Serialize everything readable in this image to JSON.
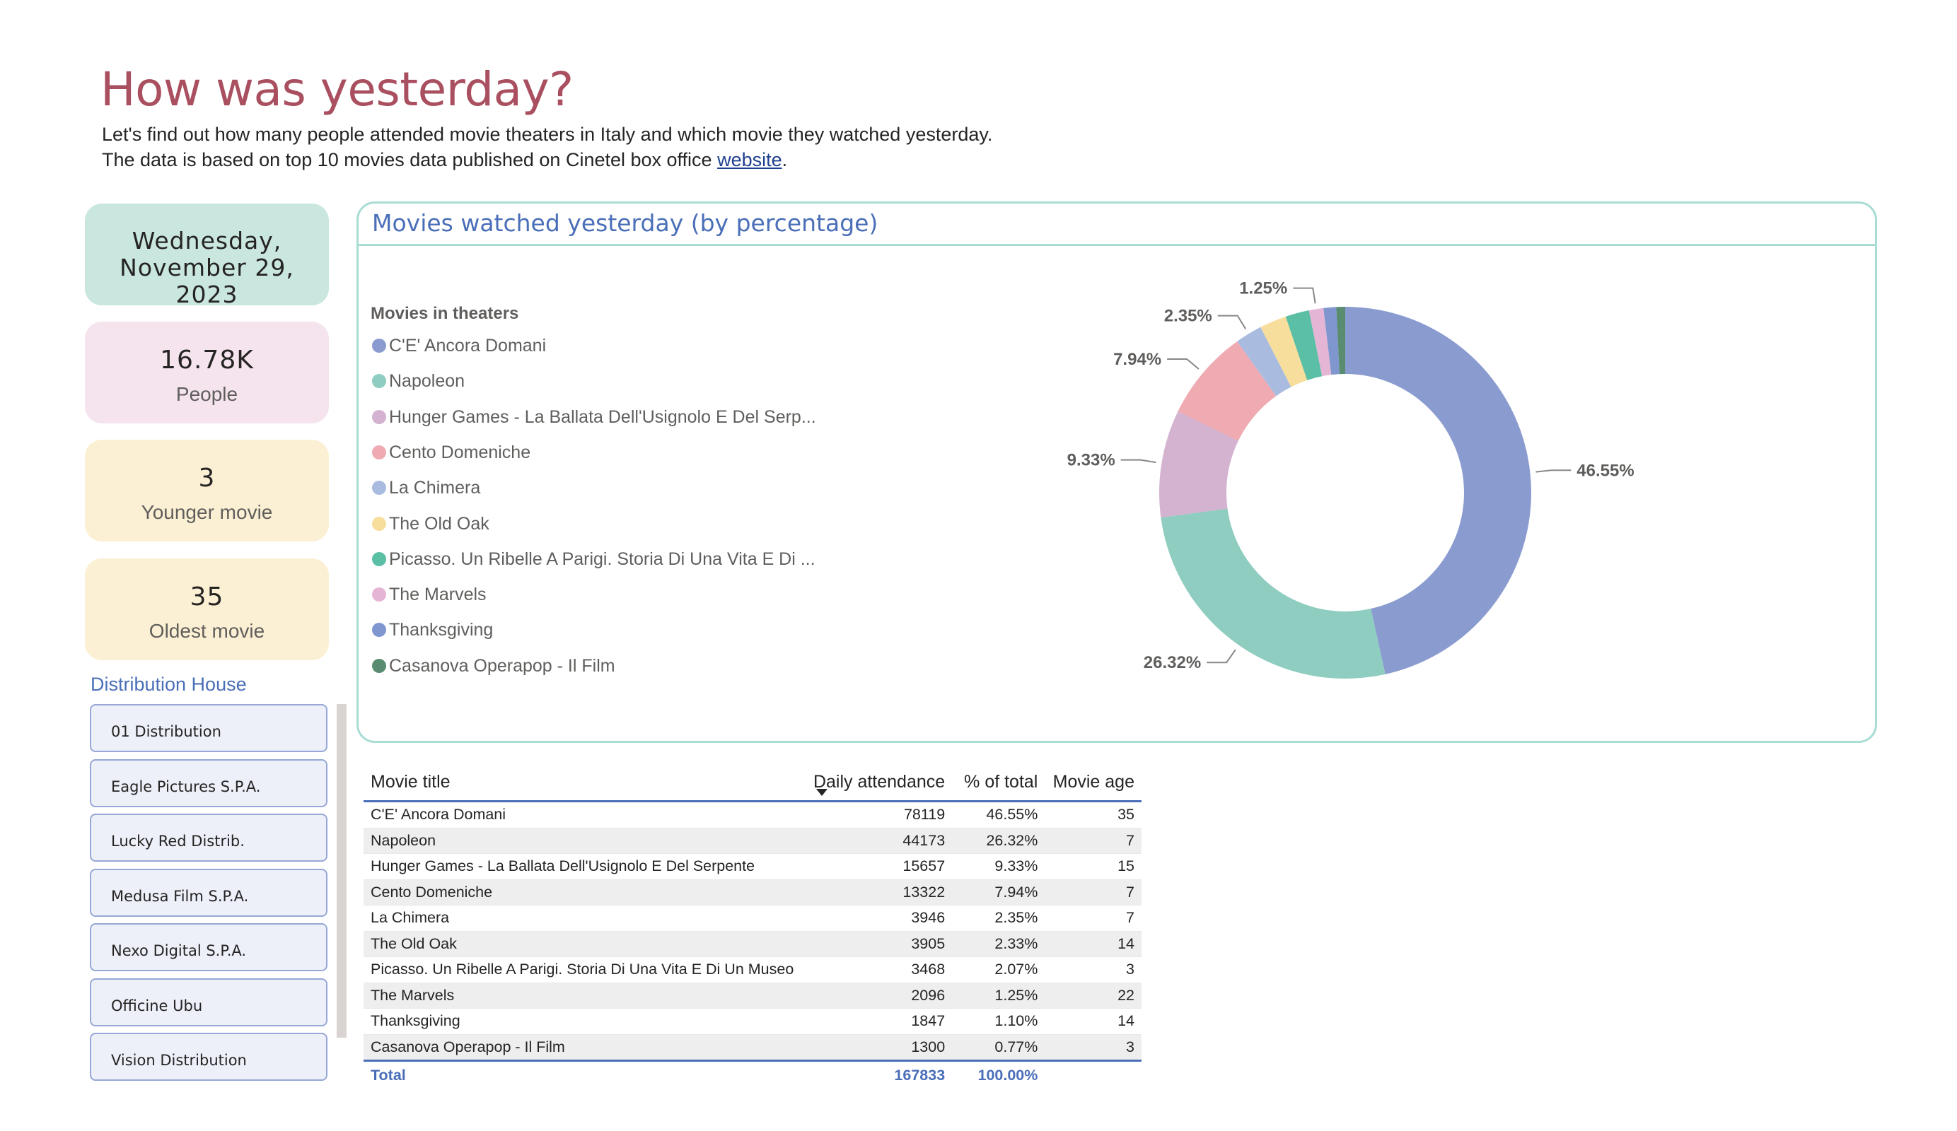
{
  "header": {
    "title": "How was yesterday?",
    "subtitle_line1": "Let's find out how many people attended movie theaters in Italy and which movie they watched yesterday.",
    "subtitle_line2_prefix": "The data is based on top 10 movies data published on Cinetel box office ",
    "subtitle_link": "website",
    "subtitle_line2_suffix": "."
  },
  "cards": {
    "date_line1": "Wednesday,",
    "date_line2": "November 29, 2023",
    "people_value": "16.78K",
    "people_label": "People",
    "younger_value": "3",
    "younger_label": "Younger movie",
    "oldest_value": "35",
    "oldest_label": "Oldest movie"
  },
  "distribution": {
    "title": "Distribution House",
    "items": [
      "01 Distribution",
      "Eagle Pictures S.P.A.",
      "Lucky Red Distrib.",
      "Medusa Film S.P.A.",
      "Nexo Digital S.P.A.",
      "Officine Ubu",
      "Vision Distribution"
    ]
  },
  "donut": {
    "title": "Movies watched yesterday (by percentage)",
    "legend_title": "Movies in theaters",
    "legend": [
      {
        "label": "C'E' Ancora Domani",
        "color": "#8a9bcf"
      },
      {
        "label": "Napoleon",
        "color": "#8ecdc0"
      },
      {
        "label": "Hunger Games - La Ballata Dell'Usignolo E Del Serp...",
        "color": "#d4b3d1"
      },
      {
        "label": "Cento Domeniche",
        "color": "#efaab2"
      },
      {
        "label": "La Chimera",
        "color": "#a9bce0"
      },
      {
        "label": "The Old Oak",
        "color": "#f8de9c"
      },
      {
        "label": "Picasso. Un Ribelle A Parigi. Storia Di Una Vita E Di ...",
        "color": "#5bbfa5"
      },
      {
        "label": "The Marvels",
        "color": "#e5b5d6"
      },
      {
        "label": "Thanksgiving",
        "color": "#7f96cf"
      },
      {
        "label": "Casanova Operapop - Il Film",
        "color": "#5a8c72"
      }
    ],
    "data_labels": [
      "46.55%",
      "26.32%",
      "9.33%",
      "7.94%",
      "2.35%",
      "1.25%"
    ]
  },
  "chart_data": {
    "type": "pie",
    "categories": [
      "C'E' Ancora Domani",
      "Napoleon",
      "Hunger Games - La Ballata Dell'Usignolo E Del Serpente",
      "Cento Domeniche",
      "La Chimera",
      "The Old Oak",
      "Picasso. Un Ribelle A Parigi. Storia Di Una Vita E Di Un Museo",
      "The Marvels",
      "Thanksgiving",
      "Casanova Operapop - Il Film"
    ],
    "values": [
      46.55,
      26.32,
      9.33,
      7.94,
      2.35,
      2.33,
      2.07,
      1.25,
      1.1,
      0.77
    ],
    "title": "Movies watched yesterday (by percentage)",
    "legend_title": "Movies in theaters",
    "legend": "left"
  },
  "table": {
    "headers": [
      "Movie title",
      "Daily attendance",
      "% of total",
      "Movie age"
    ],
    "rows": [
      [
        "C'E' Ancora Domani",
        "78119",
        "46.55%",
        "35"
      ],
      [
        "Napoleon",
        "44173",
        "26.32%",
        "7"
      ],
      [
        "Hunger Games - La Ballata Dell'Usignolo E Del Serpente",
        "15657",
        "9.33%",
        "15"
      ],
      [
        "Cento Domeniche",
        "13322",
        "7.94%",
        "7"
      ],
      [
        "La Chimera",
        "3946",
        "2.35%",
        "7"
      ],
      [
        "The Old Oak",
        "3905",
        "2.33%",
        "14"
      ],
      [
        "Picasso. Un Ribelle A Parigi. Storia Di Una Vita E Di Un Museo",
        "3468",
        "2.07%",
        "3"
      ],
      [
        "The Marvels",
        "2096",
        "1.25%",
        "22"
      ],
      [
        "Thanksgiving",
        "1847",
        "1.10%",
        "14"
      ],
      [
        "Casanova Operapop - Il Film",
        "1300",
        "0.77%",
        "3"
      ]
    ],
    "total": [
      "Total",
      "167833",
      "100.00%",
      ""
    ]
  }
}
